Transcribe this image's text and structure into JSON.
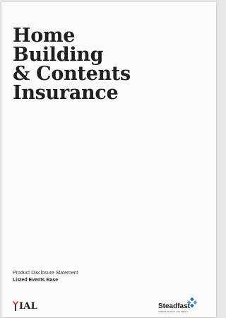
{
  "title_lines": [
    "Home",
    "Building",
    "& Contents",
    "Insurance"
  ],
  "document_type": "Product Disclosure Statement",
  "document_subtitle": "Listed Events Base",
  "logos": {
    "ial": "IAL",
    "steadfast": "Steadfast",
    "steadfast_tagline": "STRENGTH WHEN YOU NEED IT"
  },
  "colors": {
    "title": "#231f20",
    "ial_accent": "#e0292e",
    "steadfast_blue": "#2b6cb5"
  }
}
